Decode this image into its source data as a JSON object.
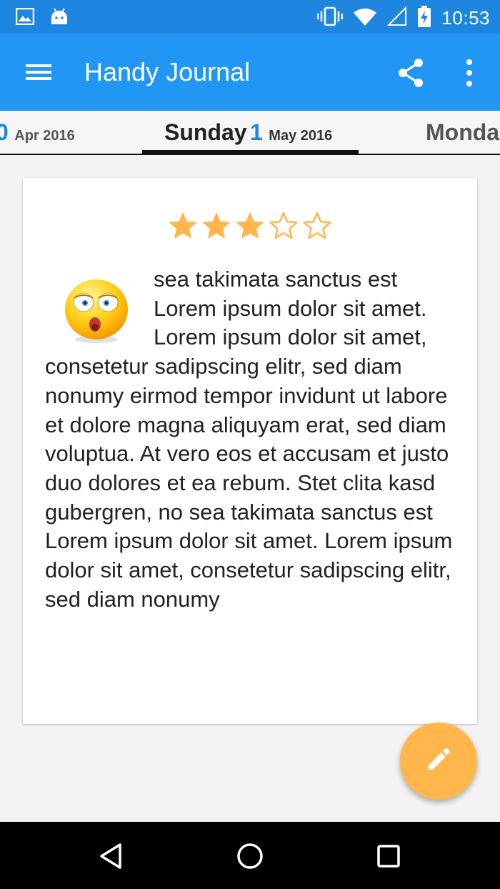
{
  "status_bar": {
    "time": "10:53",
    "icons": [
      "image-icon",
      "android-icon",
      "vibrate-icon",
      "wifi-icon",
      "signal-icon",
      "battery-charging-icon"
    ]
  },
  "app_bar": {
    "title": "Handy Journal",
    "icons": [
      "menu-icon",
      "share-icon",
      "more-vert-icon"
    ]
  },
  "date_tabs": {
    "previous": {
      "day_name": "",
      "day_number": "0",
      "month_year": "Apr 2016"
    },
    "current": {
      "day_name": "Sunday",
      "day_number": "1",
      "month_year": "May 2016"
    },
    "next": {
      "day_name": "Monda",
      "day_number": "",
      "month_year": ""
    }
  },
  "entry": {
    "rating": 3,
    "rating_max": 5,
    "mood_icon": "shocked-face-icon",
    "text": "sea takimata sanctus est Lorem ipsum dolor sit amet. Lorem ipsum dolor sit amet, consetetur sadipscing elitr, sed diam nonumy eirmod tempor invidunt ut labore et dolore magna aliquyam erat, sed diam voluptua. At vero eos et accusam et justo duo dolores et ea rebum. Stet clita kasd gubergren, no sea takimata sanctus est Lorem ipsum dolor sit amet. Lorem ipsum dolor sit amet, consetetur sadipscing elitr, sed diam nonumy"
  },
  "fab": {
    "icon": "pencil-icon"
  },
  "nav_bar": {
    "icons": [
      "back-icon",
      "home-icon",
      "recents-icon"
    ]
  },
  "colors": {
    "status_bar": "#1e86de",
    "app_bar": "#2196f3",
    "accent": "#ffb74d",
    "star": "#ffb74d",
    "day_number": "#1e86de"
  }
}
